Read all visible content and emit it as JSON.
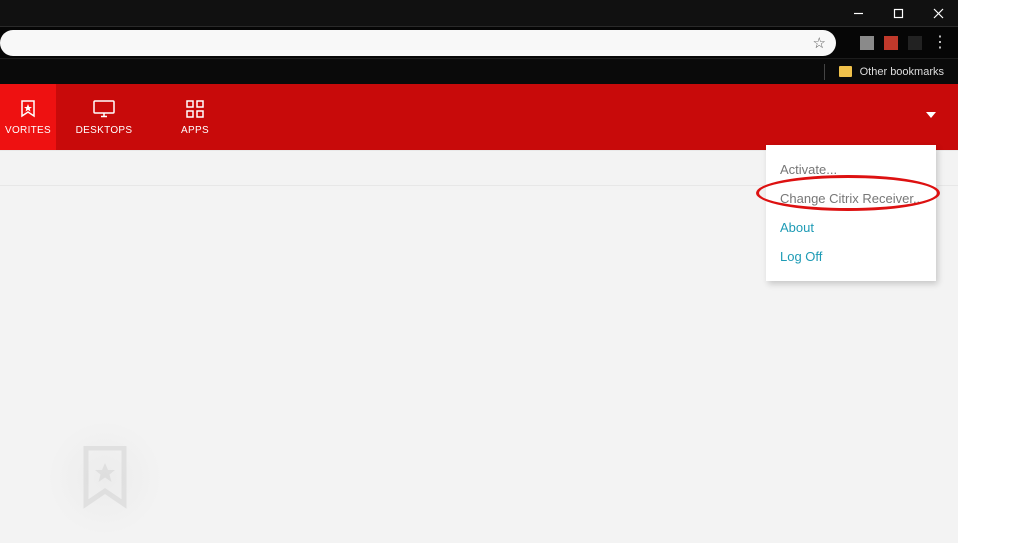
{
  "window_controls": {
    "minimize": "minimize",
    "maximize": "maximize",
    "close": "close"
  },
  "bookmarks": {
    "other_label": "Other bookmarks"
  },
  "nav": {
    "favorites": "VORITES",
    "desktops": "DESKTOPS",
    "apps": "APPS"
  },
  "menu": {
    "activate": "Activate...",
    "change_receiver": "Change Citrix Receiver...",
    "about": "About",
    "logoff": "Log Off"
  }
}
